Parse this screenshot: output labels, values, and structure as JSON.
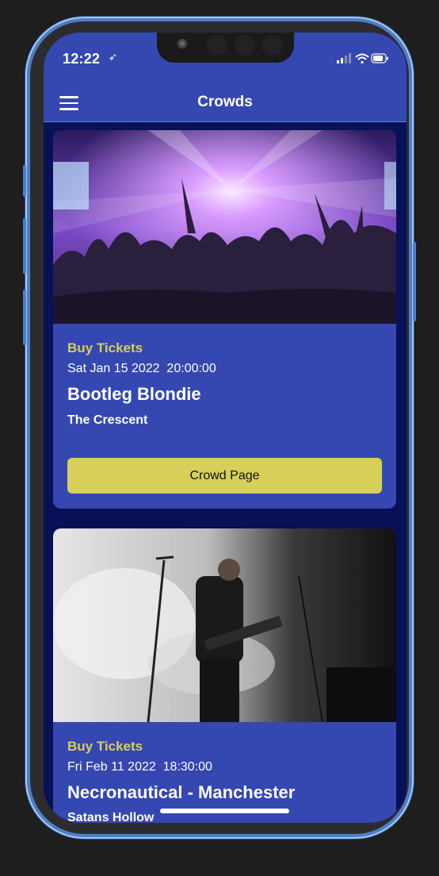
{
  "status_bar": {
    "time": "12:22",
    "location_icon": "location-arrow-icon",
    "icons": [
      "signal-icon",
      "wifi-icon",
      "battery-icon"
    ]
  },
  "app_bar": {
    "title": "Crowds",
    "menu_icon": "hamburger-menu-icon"
  },
  "colors": {
    "app_bar": "#3547b1",
    "background": "#081058",
    "accent": "#d6cf5a",
    "frame": "#4d7fc8"
  },
  "events": [
    {
      "buy_label": "Buy Tickets",
      "date": "Sat Jan 15 2022  20:00:00",
      "name": "Bootleg Blondie",
      "venue": "The Crescent",
      "button_label": "Crowd Page",
      "image": "concert-crowd-image"
    },
    {
      "buy_label": "Buy Tickets",
      "date": "Fri Feb 11 2022  18:30:00",
      "name": "Necronautical - Manchester",
      "venue": "Satans Hollow",
      "image": "guitarist-on-stage-image"
    }
  ]
}
